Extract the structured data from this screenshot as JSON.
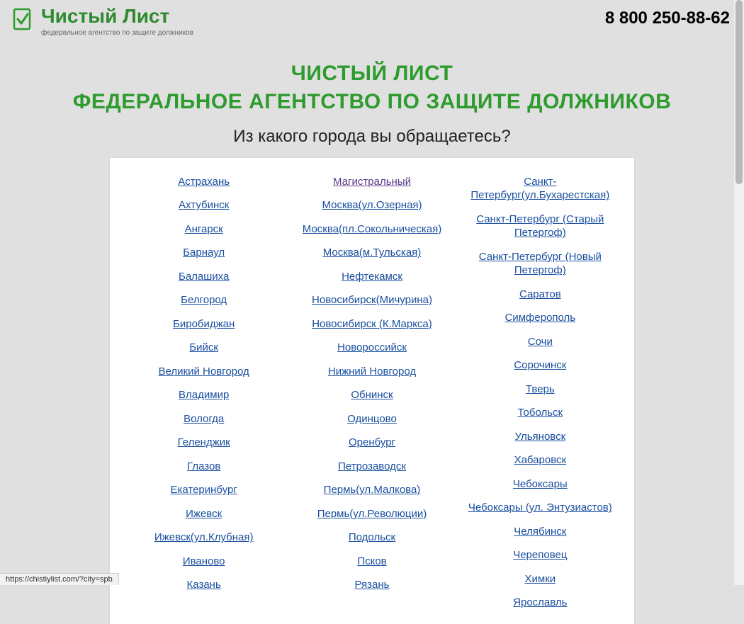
{
  "header": {
    "logo_title": "Чистый Лист",
    "logo_subtitle": "федеральное агентство по защите должников",
    "phone": "8 800 250-88-62"
  },
  "main": {
    "title_line1": "ЧИСТЫЙ ЛИСТ",
    "title_line2": "ФЕДЕРАЛЬНОЕ АГЕНТСТВО ПО ЗАЩИТЕ ДОЛЖНИКОВ",
    "question": "Из какого города вы обращаетесь?"
  },
  "cities": {
    "col1": [
      "Астрахань",
      "Ахтубинск",
      "Ангарск",
      "Барнаул",
      "Балашиха",
      "Белгород",
      "Биробиджан",
      "Бийск",
      "Великий Новгород",
      "Владимир",
      "Вологда",
      "Геленджик",
      "Глазов",
      "Екатеринбург",
      "Ижевск",
      "Ижевск(ул.Клубная)",
      "Иваново",
      "Казань"
    ],
    "col2": [
      "Магистральный",
      "Москва(ул.Озерная)",
      "Москва(пл.Сокольническая)",
      "Москва(м.Тульская)",
      "Нефтекамск",
      "Новосибирск(Мичурина)",
      "Новосибирск (К.Маркса)",
      "Новороссийск",
      "Нижний Новгород",
      "Обнинск",
      "Одинцово",
      "Оренбург",
      "Петрозаводск",
      "Пермь(ул.Малкова)",
      "Пермь(ул.Революции)",
      "Подольск",
      "Псков",
      "Рязань"
    ],
    "col3": [
      "Санкт-Петербург(ул.Бухарестская)",
      "Санкт-Петербург (Старый Петергоф)",
      "Санкт-Петербург (Новый Петергоф)",
      "Саратов",
      "Симферополь",
      "Сочи",
      "Сорочинск",
      "Тверь",
      "Тобольск",
      "Ульяновск",
      "Хабаровск",
      "Чебоксары",
      "Чебоксары (ул. Энтузиастов)",
      "Челябинск",
      "Череповец",
      "Химки",
      "Ярославль"
    ]
  },
  "visited_link_index": {
    "col": 1,
    "idx": 0
  },
  "status_bar": "https://chistiylist.com/?city=spb"
}
